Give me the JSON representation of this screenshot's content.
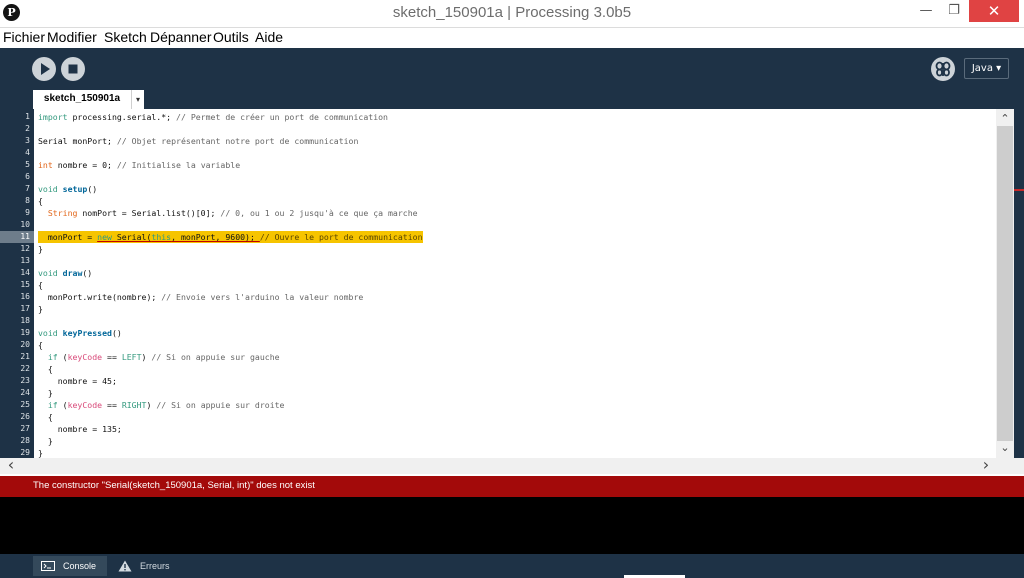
{
  "window": {
    "title": "sketch_150901a | Processing 3.0b5",
    "logo_glyph": "P",
    "minimize_glyph": "—",
    "maximize_glyph": "❐",
    "close_glyph": "✕"
  },
  "menu": [
    "Fichier",
    "Modifier",
    "Sketch",
    "Dépanner",
    "Outils",
    "Aide"
  ],
  "toolbar": {
    "mode": "Java ▾"
  },
  "tabs": {
    "active": "sketch_150901a",
    "menu_glyph": "▾"
  },
  "editor": {
    "line_numbers": [
      "1",
      "2",
      "3",
      "4",
      "5",
      "6",
      "7",
      "8",
      "9",
      "10",
      "11",
      "12",
      "13",
      "14",
      "15",
      "16",
      "17",
      "18",
      "19",
      "20",
      "21",
      "22",
      "23",
      "24",
      "25",
      "26",
      "27",
      "28",
      "29"
    ],
    "current_line": 11,
    "code": {
      "l1": {
        "a": "import",
        "b": " processing.serial.*; ",
        "c": "// Permet de créer un port de communication"
      },
      "l3": {
        "a": "Serial monPort; ",
        "b": "// Objet représentant notre port de communication"
      },
      "l5": {
        "a": "int",
        "b": " nombre = 0; ",
        "c": "// Initialise la variable"
      },
      "l7": {
        "a": "void",
        "b": " ",
        "c": "setup",
        "d": "()"
      },
      "l8": {
        "a": "{"
      },
      "l9": {
        "a": "  ",
        "b": "String",
        "c": " nomPort = Serial.list()[0]; ",
        "d": "// 0, ou 1 ou 2 jusqu'à ce que ça marche"
      },
      "l11": {
        "a": "  monPort = ",
        "b": "new",
        "c": " Serial(",
        "d": "this",
        "e": ", monPort, 9600); ",
        "f": "// Ouvre le port de communication"
      },
      "l12": {
        "a": "}"
      },
      "l14": {
        "a": "void",
        "b": " ",
        "c": "draw",
        "d": "()"
      },
      "l15": {
        "a": "{"
      },
      "l16": {
        "a": "  monPort.write(nombre); ",
        "b": "// Envoie vers l'arduino la valeur nombre"
      },
      "l17": {
        "a": "}"
      },
      "l19": {
        "a": "void",
        "b": " ",
        "c": "keyPressed",
        "d": "()"
      },
      "l20": {
        "a": "{"
      },
      "l21": {
        "a": "  ",
        "b": "if",
        "c": " (",
        "d": "keyCode",
        "e": " == ",
        "f": "LEFT",
        "g": ") ",
        "h": "// Si on appuie sur gauche"
      },
      "l22": {
        "a": "  {"
      },
      "l23": {
        "a": "    nombre = 45;"
      },
      "l24": {
        "a": "  }"
      },
      "l25": {
        "a": "  ",
        "b": "if",
        "c": " (",
        "d": "keyCode",
        "e": " == ",
        "f": "RIGHT",
        "g": ") ",
        "h": "// Si on appuie sur droite"
      },
      "l26": {
        "a": "  {"
      },
      "l27": {
        "a": "    nombre = 135;"
      },
      "l28": {
        "a": "  }"
      },
      "l29": {
        "a": "}"
      }
    },
    "scroll_up_glyph": "⌃",
    "scroll_down_glyph": "⌄",
    "scroll_left_glyph": "‹",
    "scroll_right_glyph": "›"
  },
  "status": {
    "message": "The constructor \"Serial(sketch_150901a, Serial,  int)\" does not exist"
  },
  "footer": {
    "console_label": "Console",
    "errors_label": "Erreurs"
  },
  "colors": {
    "toolbar_bg": "#1e3246",
    "highlight": "#f6c400",
    "error_bar": "#a30a0a",
    "close_button": "#e04343"
  }
}
